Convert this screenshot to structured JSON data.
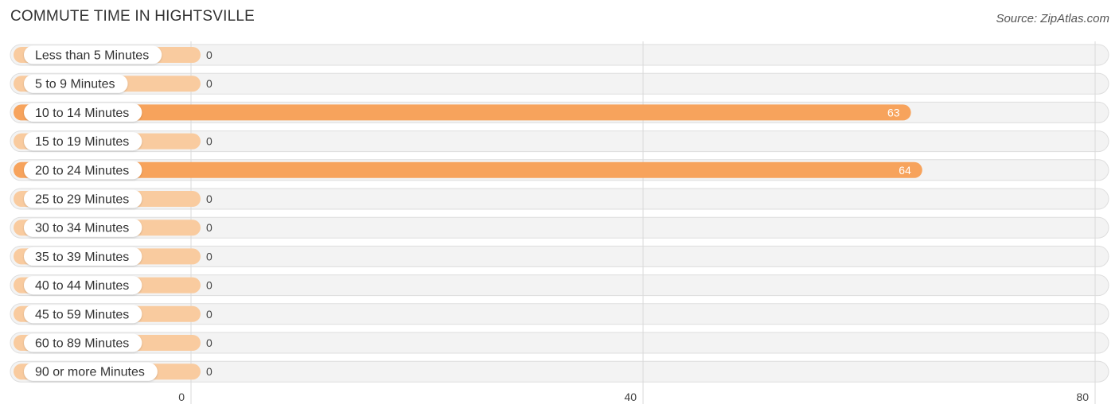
{
  "header": {
    "title": "COMMUTE TIME IN HIGHTSVILLE",
    "source": "Source: ZipAtlas.com"
  },
  "chart_data": {
    "type": "bar",
    "orientation": "horizontal",
    "title": "COMMUTE TIME IN HIGHTSVILLE",
    "source": "Source: ZipAtlas.com",
    "xlabel": "",
    "ylabel": "",
    "xlim": [
      0,
      80
    ],
    "xticks": [
      0,
      40,
      80
    ],
    "grid": true,
    "categories": [
      "Less than 5 Minutes",
      "5 to 9 Minutes",
      "10 to 14 Minutes",
      "15 to 19 Minutes",
      "20 to 24 Minutes",
      "25 to 29 Minutes",
      "30 to 34 Minutes",
      "35 to 39 Minutes",
      "40 to 44 Minutes",
      "45 to 59 Minutes",
      "60 to 89 Minutes",
      "90 or more Minutes"
    ],
    "values": [
      0,
      0,
      63,
      0,
      64,
      0,
      0,
      0,
      0,
      0,
      0,
      0
    ],
    "colors": {
      "bar_strong": "#f7a35c",
      "bar_light": "#f9cb9f",
      "track": "#f3f3f3"
    }
  }
}
